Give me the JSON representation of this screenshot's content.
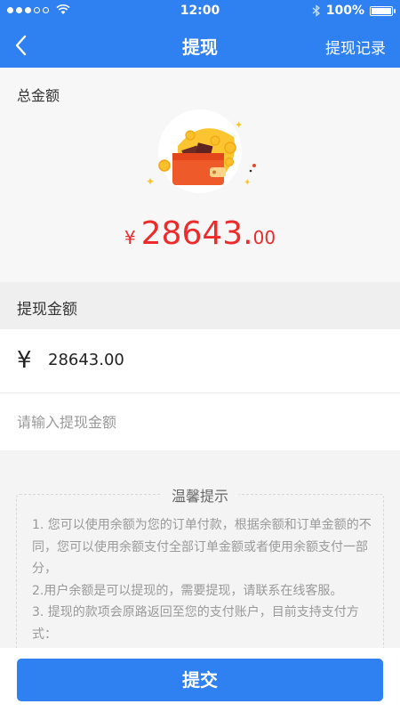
{
  "status_bar": {
    "time": "12:00",
    "battery": "100%",
    "battery_level": 1.0
  },
  "nav": {
    "title": "提现",
    "right_link": "提现记录"
  },
  "total": {
    "label": "总金额",
    "currency": "¥",
    "amount_int": "28643.",
    "amount_dec": "00"
  },
  "withdraw": {
    "section_label": "提现金额",
    "currency_symbol": "¥",
    "amount": "28643.00",
    "input_placeholder": "请输入提现金额"
  },
  "tips": {
    "title": "温馨提示",
    "lines": [
      "1. 您可以使用余额为您的订单付款，根据余额和订单金额的不同，您可以使用余额支付全部订单金额或者使用余额支付一部分，",
      "2.用户余额是可以提现的，需要提现，请联系在线客服。",
      "3. 提现的款项会原路返回至您的支付账户，目前支持支付方式："
    ]
  },
  "submit": {
    "label": "提交"
  },
  "colors": {
    "primary": "#2f80f0",
    "amount_red": "#ee2b2b"
  }
}
